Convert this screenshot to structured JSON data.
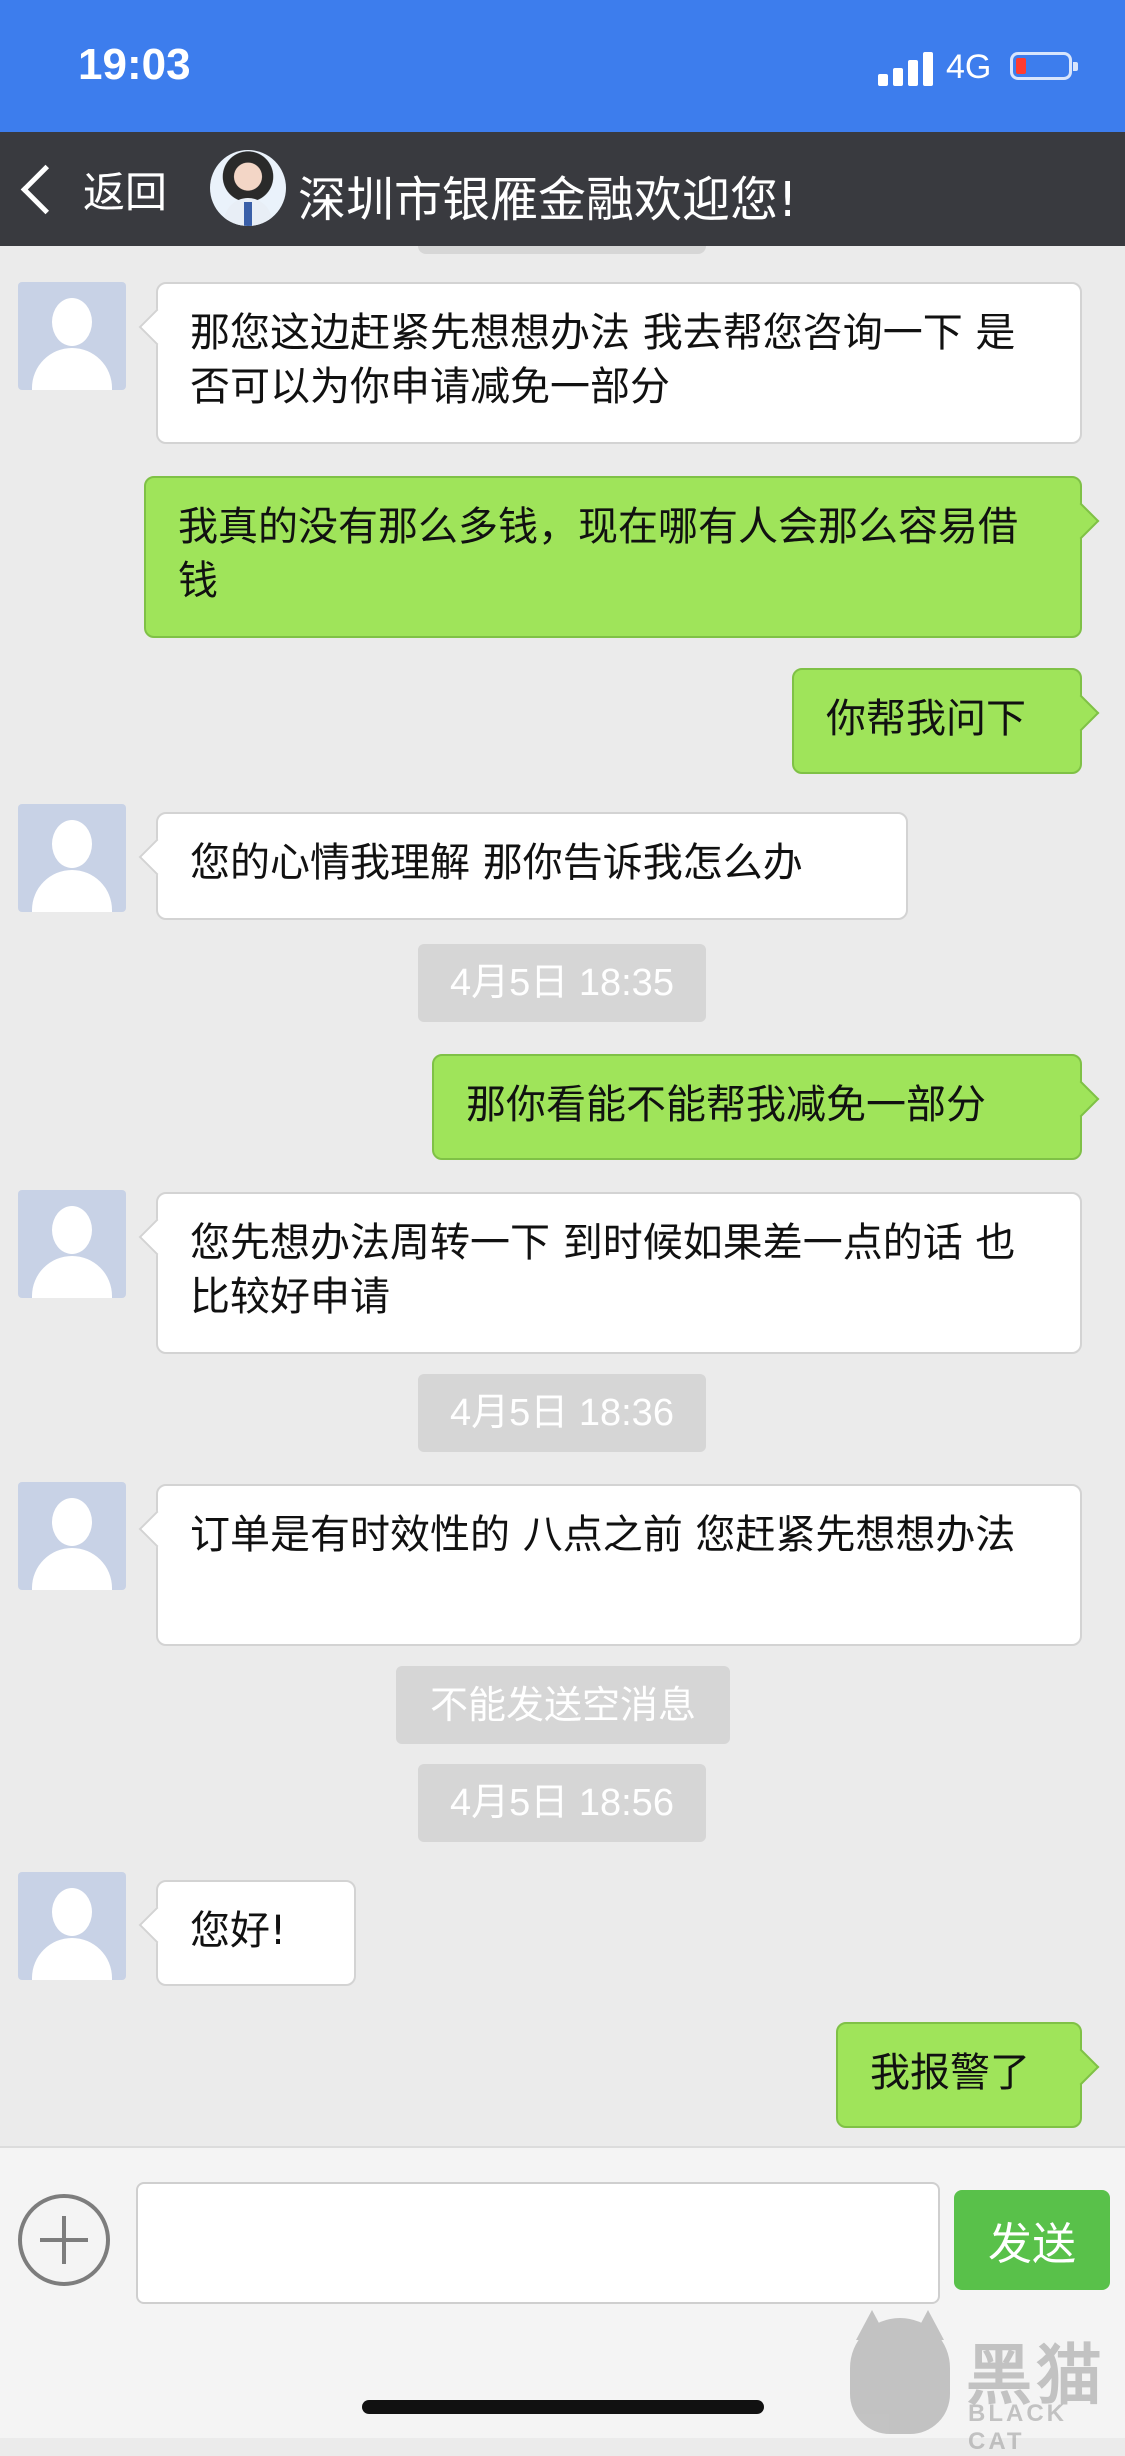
{
  "status_bar": {
    "time": "19:03",
    "network": "4G",
    "signal_icon": "signal-bars-icon",
    "battery_icon": "battery-low-icon",
    "battery_color": "#ff3b30",
    "background": "#3d7ded"
  },
  "nav": {
    "back_label": "返回",
    "title": "深圳市银雁金融欢迎您!",
    "background": "#393a3f"
  },
  "messages": [
    {
      "side": "left",
      "text": "那您这边赶紧先想想办法 我去帮您咨询一下 是否可以为你申请减免一部分"
    },
    {
      "side": "right",
      "text": "我真的没有那么多钱，现在哪有人会那么容易借钱"
    },
    {
      "side": "right",
      "text": "你帮我问下"
    },
    {
      "side": "left",
      "text": "您的心情我理解 那你告诉我怎么办"
    },
    {
      "type": "time",
      "text": "4月5日 18:35"
    },
    {
      "side": "right",
      "text": "那你看能不能帮我减免一部分"
    },
    {
      "side": "left",
      "text": "您先想办法周转一下 到时候如果差一点的话 也比较好申请"
    },
    {
      "type": "time",
      "text": "4月5日 18:36"
    },
    {
      "side": "left",
      "text": "订单是有时效性的 八点之前 您赶紧先想想办法"
    },
    {
      "type": "notice",
      "text": "不能发送空消息"
    },
    {
      "type": "time",
      "text": "4月5日 18:56"
    },
    {
      "side": "left",
      "text": "您好!"
    },
    {
      "side": "right",
      "text": "我报警了"
    }
  ],
  "input_bar": {
    "plus_icon": "plus-circle-icon",
    "input_value": "",
    "input_placeholder": "",
    "send_label": "发送",
    "send_color": "#59c14a"
  },
  "colors": {
    "chat_background": "#ebebeb",
    "outgoing_bubble": "#9fe45a",
    "incoming_bubble": "#ffffff"
  },
  "watermark": {
    "text_cn": "黑猫",
    "text_en": "BLACK CAT"
  }
}
